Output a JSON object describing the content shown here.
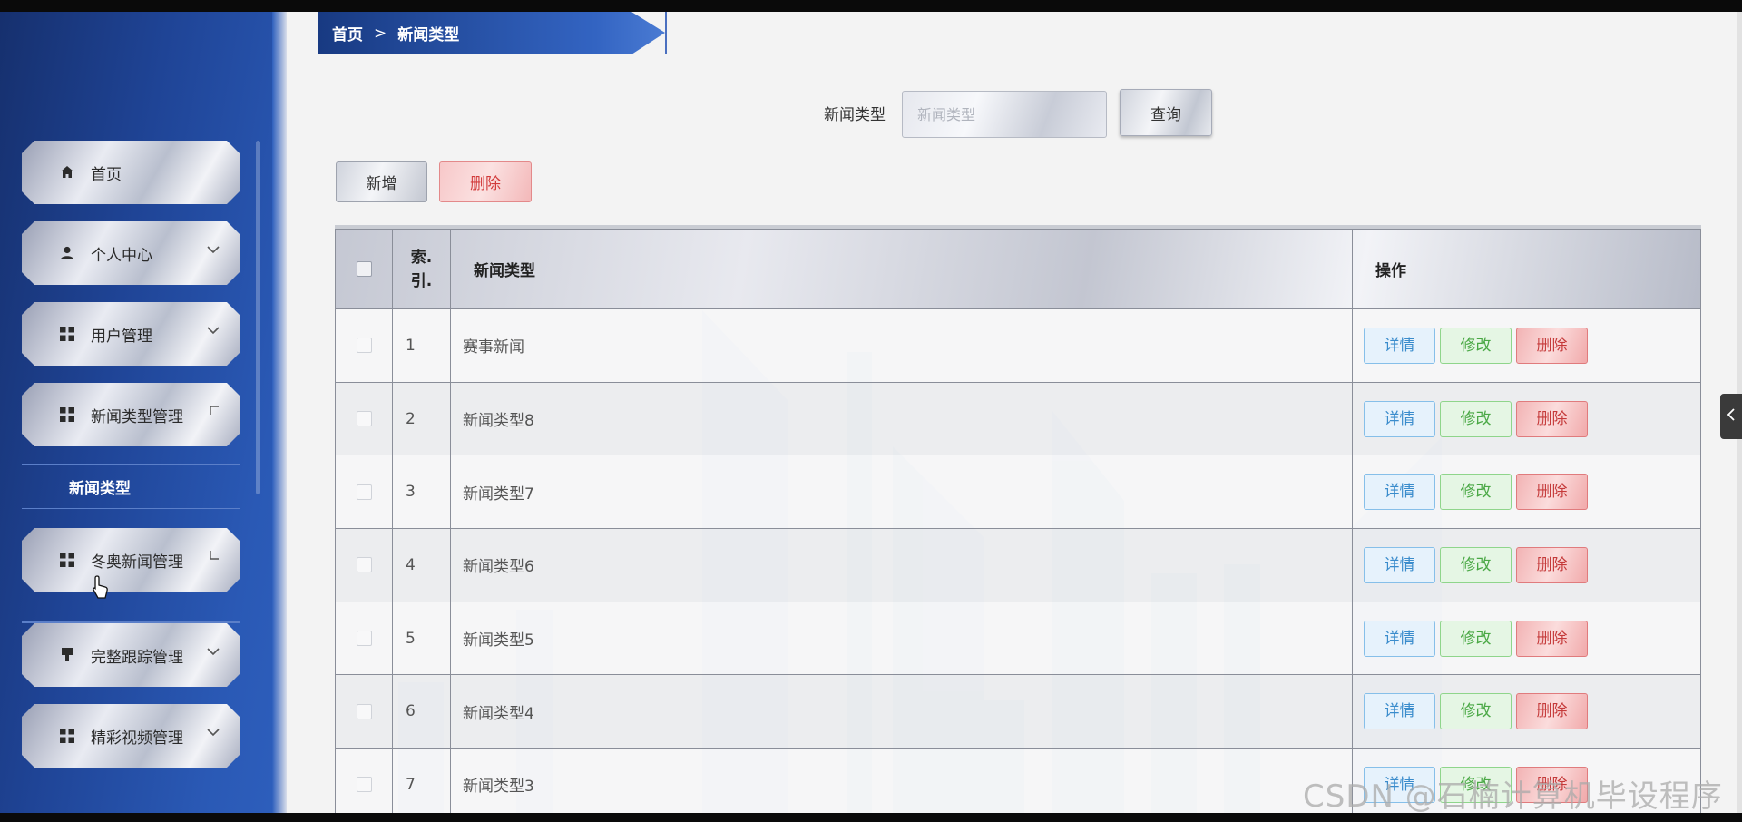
{
  "breadcrumb": {
    "home": "首页",
    "separator": ">",
    "current": "新闻类型"
  },
  "sidebar": {
    "items": [
      {
        "label": "首页",
        "icon": "home-icon"
      },
      {
        "label": "个人中心",
        "icon": "user-icon",
        "arrow": "chevron-down"
      },
      {
        "label": "用户管理",
        "icon": "grid-icon",
        "arrow": "chevron-down"
      },
      {
        "label": "新闻类型管理",
        "icon": "grid-icon",
        "arrow": "corner"
      },
      {
        "label": "冬奥新闻管理",
        "icon": "grid-icon",
        "arrow": "corner"
      },
      {
        "label": "完整跟踪管理",
        "icon": "pin-icon",
        "arrow": "chevron-down"
      },
      {
        "label": "精彩视频管理",
        "icon": "grid-icon",
        "arrow": "chevron-down"
      }
    ],
    "submenu": {
      "label": "新闻类型"
    }
  },
  "search": {
    "label": "新闻类型",
    "placeholder": "新闻类型",
    "button": "查询"
  },
  "toolbar": {
    "add": "新增",
    "delete": "删除"
  },
  "table": {
    "headers": {
      "index_line1": "索.",
      "index_line2": "引.",
      "type": "新闻类型",
      "ops": "操作"
    },
    "rows": [
      {
        "index": "1",
        "type": "赛事新闻"
      },
      {
        "index": "2",
        "type": "新闻类型8"
      },
      {
        "index": "3",
        "type": "新闻类型7"
      },
      {
        "index": "4",
        "type": "新闻类型6"
      },
      {
        "index": "5",
        "type": "新闻类型5"
      },
      {
        "index": "6",
        "type": "新闻类型4"
      },
      {
        "index": "7",
        "type": "新闻类型3"
      }
    ],
    "actions": {
      "detail": "详情",
      "edit": "修改",
      "delete": "删除"
    }
  },
  "watermark": "CSDN @石楠计算机毕设程序",
  "colors": {
    "sidebar": "#1f4496",
    "breadcrumb": "#3364c2",
    "danger": "#d23b3b",
    "info": "#3a8ccc",
    "success": "#4aa845"
  }
}
